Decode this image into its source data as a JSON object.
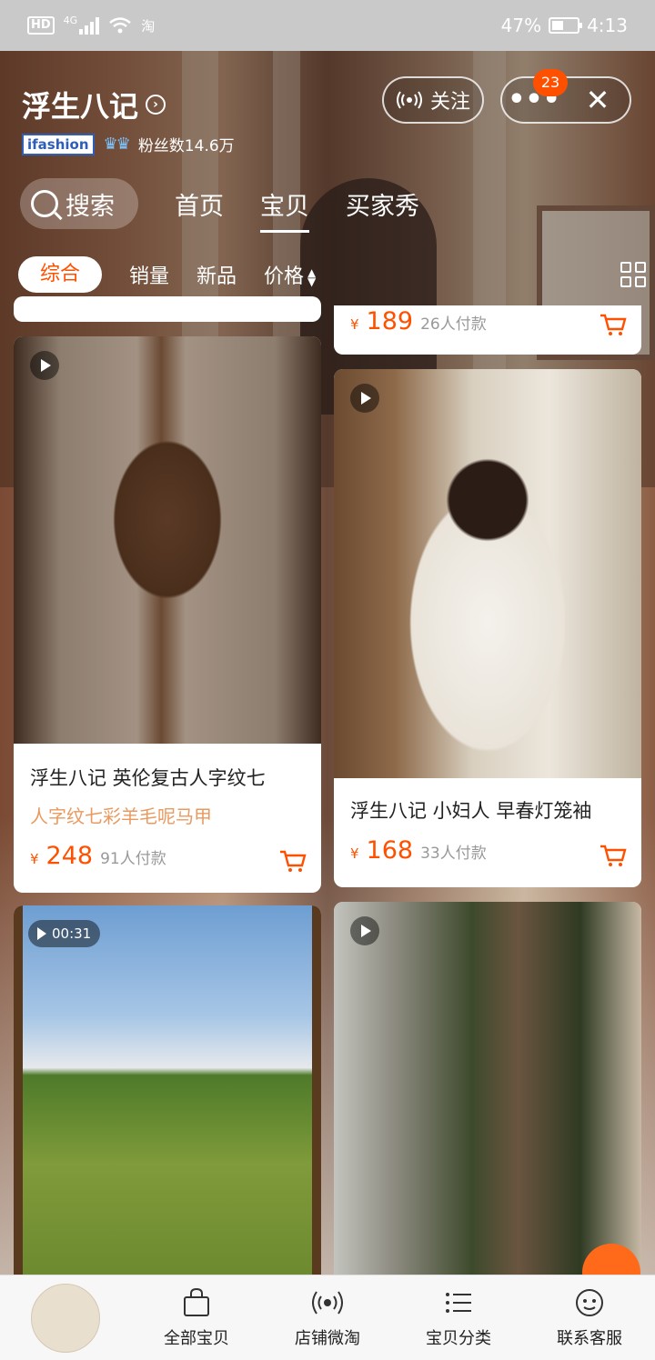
{
  "status_bar": {
    "hd": "HD",
    "network": "4G",
    "carrier_icon": "淘",
    "battery": "47%",
    "time": "4:13"
  },
  "shop": {
    "name": "浮生八记",
    "brand_tag": "ifashion",
    "fans": "粉丝数14.6万",
    "follow_label": "关注",
    "badge_count": "23"
  },
  "nav": {
    "search_label": "搜索",
    "tabs": [
      {
        "label": "首页"
      },
      {
        "label": "宝贝"
      },
      {
        "label": "买家秀"
      }
    ],
    "active_tab": "宝贝"
  },
  "filters": {
    "items": [
      {
        "label": "综合"
      },
      {
        "label": "销量"
      },
      {
        "label": "新品"
      },
      {
        "label": "价格"
      }
    ],
    "active": "综合"
  },
  "products": [
    {
      "price": "189",
      "sold": "26人付款"
    },
    {
      "title": "浮生八记 英伦复古人字纹七",
      "subtitle": "人字纹七彩羊毛呢马甲",
      "price": "248",
      "sold": "91人付款"
    },
    {
      "title": "浮生八记 小妇人 早春灯笼袖",
      "price": "168",
      "sold": "33人付款"
    },
    {
      "video_duration": "00:31"
    },
    {}
  ],
  "currency_symbol": "¥",
  "bottom_bar": {
    "items": [
      {
        "label": "全部宝贝",
        "icon": "shopping-bag-icon"
      },
      {
        "label": "店铺微淘",
        "icon": "broadcast-icon"
      },
      {
        "label": "宝贝分类",
        "icon": "list-icon"
      },
      {
        "label": "联系客服",
        "icon": "chat-icon"
      }
    ]
  },
  "colors": {
    "accent": "#ff5000",
    "subtitle": "#e99a60"
  }
}
